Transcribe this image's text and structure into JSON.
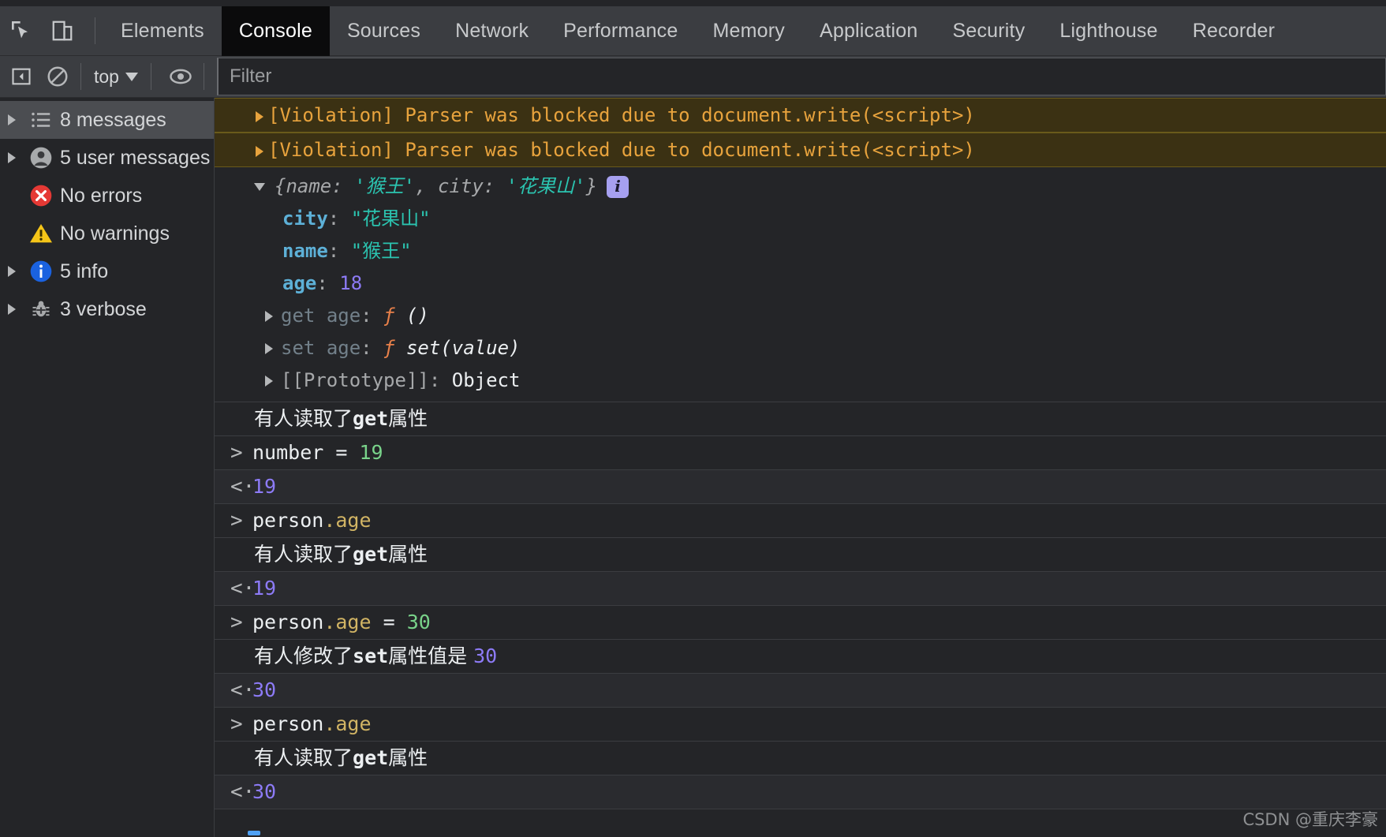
{
  "window": {
    "title": "Chrome DevTools - Console"
  },
  "toolbar": {
    "inspect_icon": "inspect-element-icon",
    "device_icon": "device-toolbar-icon",
    "tabs": [
      {
        "label": "Elements",
        "active": false
      },
      {
        "label": "Console",
        "active": true
      },
      {
        "label": "Sources",
        "active": false
      },
      {
        "label": "Network",
        "active": false
      },
      {
        "label": "Performance",
        "active": false
      },
      {
        "label": "Memory",
        "active": false
      },
      {
        "label": "Application",
        "active": false
      },
      {
        "label": "Security",
        "active": false
      },
      {
        "label": "Lighthouse",
        "active": false
      },
      {
        "label": "Recorder",
        "active": false
      }
    ]
  },
  "filterbar": {
    "sidebar_toggle_icon": "console-sidebar-toggle-icon",
    "clear_icon": "clear-console-icon",
    "context": "top",
    "eye_icon": "live-expression-icon",
    "filter_placeholder": "Filter",
    "filter_value": ""
  },
  "sidebar": {
    "items": [
      {
        "label": "8 messages",
        "icon": "list-icon",
        "arrow": true,
        "selected": true
      },
      {
        "label": "5 user messages",
        "icon": "user-icon",
        "arrow": true,
        "selected": false
      },
      {
        "label": "No errors",
        "icon": "error-icon",
        "arrow": false,
        "selected": false
      },
      {
        "label": "No warnings",
        "icon": "warning-icon",
        "arrow": false,
        "selected": false
      },
      {
        "label": "5 info",
        "icon": "info-icon",
        "arrow": true,
        "selected": false
      },
      {
        "label": "3 verbose",
        "icon": "bug-icon",
        "arrow": true,
        "selected": false
      }
    ]
  },
  "console": {
    "warnings": [
      "[Violation] Parser was blocked due to document.write(<script>)",
      "[Violation] Parser was blocked due to document.write(<script>)"
    ],
    "object": {
      "preview_open_brace": "{",
      "preview_key1": "name",
      "preview_colon": ": ",
      "preview_val1": "'猴王'",
      "preview_comma": ", ",
      "preview_key2": "city",
      "preview_val2": "'花果山'",
      "preview_close_brace": "}",
      "info_badge": "i",
      "props": [
        {
          "key": "city",
          "sep": ": ",
          "value": "\"花果山\"",
          "kind": "string",
          "arrow": false
        },
        {
          "key": "name",
          "sep": ": ",
          "value": "\"猴王\"",
          "kind": "string",
          "arrow": false
        },
        {
          "key": "age",
          "sep": ": ",
          "value": "18",
          "kind": "number",
          "arrow": false
        }
      ],
      "accessors": [
        {
          "prefix": "get",
          "key": "age",
          "sep": ": ",
          "fn": "ƒ",
          "sig": "()",
          "arrow": true
        },
        {
          "prefix": "set",
          "key": "age",
          "sep": ": ",
          "fn": "ƒ",
          "sig": "set(value)",
          "arrow": true
        }
      ],
      "prototype": {
        "label": "[[Prototype]]",
        "sep": ": ",
        "value": "Object",
        "arrow": true
      }
    },
    "entries": [
      {
        "type": "log",
        "text_pre": "有人读取了",
        "text_mono": "get",
        "text_post": "属性"
      },
      {
        "type": "input",
        "mark": ">",
        "parts": [
          {
            "t": "number = ",
            "c": "white"
          },
          {
            "t": "19",
            "c": "green"
          }
        ]
      },
      {
        "type": "output",
        "mark": "<·",
        "parts": [
          {
            "t": "19",
            "c": "num"
          }
        ]
      },
      {
        "type": "input",
        "mark": ">",
        "parts": [
          {
            "t": "person",
            "c": "white"
          },
          {
            "t": ".age",
            "c": "gold"
          }
        ]
      },
      {
        "type": "log",
        "text_pre": "有人读取了",
        "text_mono": "get",
        "text_post": "属性"
      },
      {
        "type": "output",
        "mark": "<·",
        "parts": [
          {
            "t": "19",
            "c": "num"
          }
        ]
      },
      {
        "type": "input",
        "mark": ">",
        "parts": [
          {
            "t": "person",
            "c": "white"
          },
          {
            "t": ".age",
            "c": "gold"
          },
          {
            "t": " = ",
            "c": "white"
          },
          {
            "t": "30",
            "c": "green"
          }
        ]
      },
      {
        "type": "log",
        "text_pre": "有人修改了",
        "text_mono": "set",
        "text_post": "属性值是 ",
        "text_num": "30"
      },
      {
        "type": "output",
        "mark": "<·",
        "parts": [
          {
            "t": "30",
            "c": "num"
          }
        ]
      },
      {
        "type": "input",
        "mark": ">",
        "parts": [
          {
            "t": "person",
            "c": "white"
          },
          {
            "t": ".age",
            "c": "gold"
          }
        ]
      },
      {
        "type": "log",
        "text_pre": "有人读取了",
        "text_mono": "get",
        "text_post": "属性"
      },
      {
        "type": "output",
        "mark": "<·",
        "parts": [
          {
            "t": "30",
            "c": "num"
          }
        ]
      }
    ]
  },
  "watermark": "CSDN @重庆李豪",
  "colors": {
    "panel_bg": "#242528",
    "toolbar_bg": "#3b3d41",
    "active_tab_bg": "#0b0b0c",
    "warning_bg": "#3b3113",
    "warning_text": "#e8a33d",
    "string_teal": "#2bc4b0",
    "number_purple": "#8d7bf7",
    "key_blue": "#5db0d7",
    "fn_orange": "#e8804a",
    "green": "#79d38a",
    "gold": "#d1b464",
    "info_badge": "#a6a0f0",
    "error_red": "#e53935",
    "warning_yellow": "#f5c518",
    "info_blue": "#1a62e0"
  }
}
